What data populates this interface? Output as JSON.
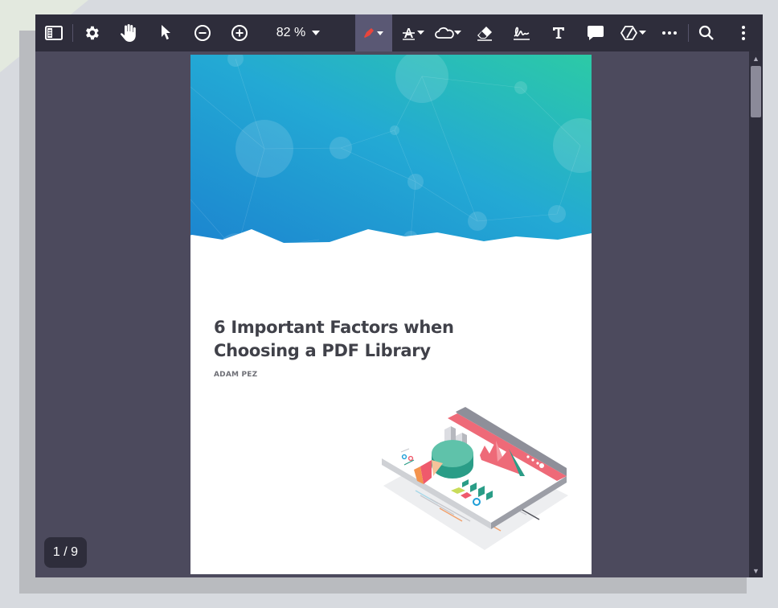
{
  "toolbar": {
    "buttons": [
      {
        "name": "sidebar-toggle-button",
        "icon": "sidebar-icon"
      },
      {
        "name": "settings-button",
        "icon": "gear-icon"
      },
      {
        "name": "pan-tool-button",
        "icon": "hand-icon"
      },
      {
        "name": "select-tool-button",
        "icon": "pointer-icon"
      },
      {
        "name": "zoom-out-button",
        "icon": "minus-circle-icon"
      },
      {
        "name": "zoom-in-button",
        "icon": "plus-circle-icon"
      },
      {
        "name": "highlighter-button",
        "icon": "highlighter-icon"
      },
      {
        "name": "text-style-button",
        "icon": "text-strike-icon"
      },
      {
        "name": "cloud-shape-button",
        "icon": "cloud-icon"
      },
      {
        "name": "eraser-button",
        "icon": "eraser-icon"
      },
      {
        "name": "signature-button",
        "icon": "signature-icon"
      },
      {
        "name": "free-text-button",
        "icon": "text-icon"
      },
      {
        "name": "comment-button",
        "icon": "speech-bubble-icon"
      },
      {
        "name": "shapes-button",
        "icon": "shapes-icon"
      },
      {
        "name": "more-tools-button",
        "icon": "ellipsis-icon"
      },
      {
        "name": "search-button",
        "icon": "search-icon"
      },
      {
        "name": "menu-button",
        "icon": "kebab-menu-icon"
      }
    ],
    "zoom_value": "82",
    "zoom_unit": "%",
    "active_tool_color": "#e8453c"
  },
  "document": {
    "title": "6 Important Factors when Choosing a PDF Library",
    "author": "ADAM PEZ"
  },
  "pagination": {
    "label": "1 / 9"
  },
  "colors": {
    "toolbar_bg": "#2e2d3b",
    "viewer_bg": "#4c4a5d",
    "header_gradient_start": "#1b7fcf",
    "header_gradient_end": "#2ccaa6"
  }
}
